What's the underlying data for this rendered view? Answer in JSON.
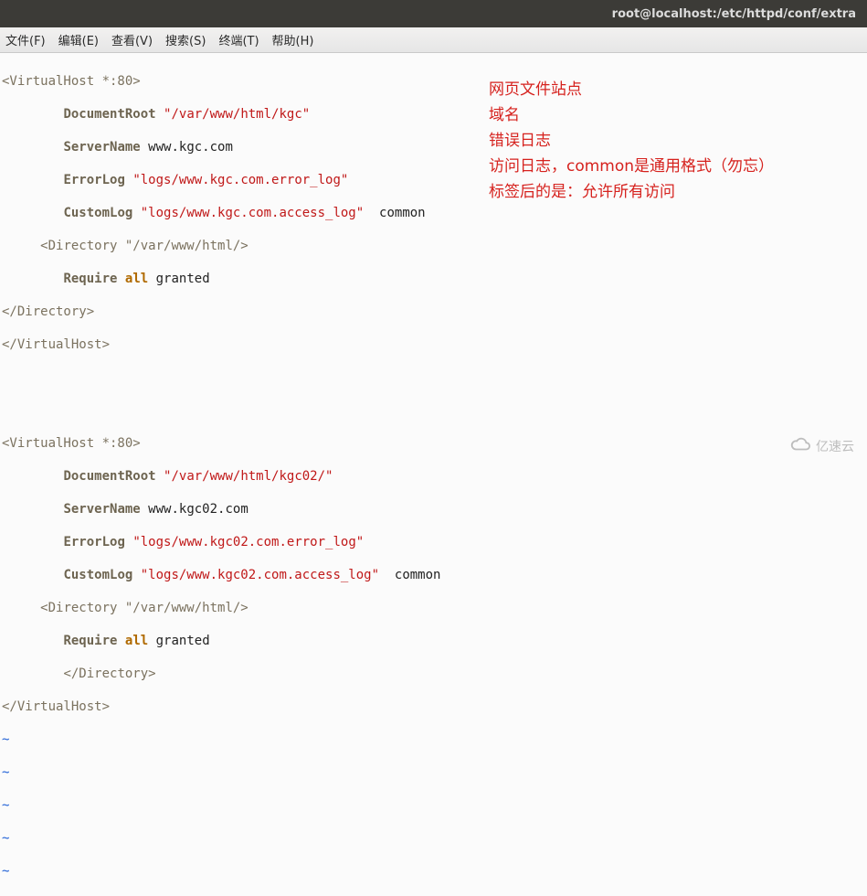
{
  "window": {
    "title": "root@localhost:/etc/httpd/conf/extra"
  },
  "menu": {
    "file": "文件(F)",
    "edit": "编辑(E)",
    "view": "查看(V)",
    "search": "搜索(S)",
    "term": "终端(T)",
    "help": "帮助(H)"
  },
  "vh1": {
    "open": "<VirtualHost *:80>",
    "docroot_k": "DocumentRoot",
    "docroot_v": "\"/var/www/html/kgc\"",
    "sname_k": "ServerName",
    "sname_v": "www.kgc.com",
    "elog_k": "ErrorLog",
    "elog_v": "\"logs/www.kgc.com.error_log\"",
    "clog_k": "CustomLog",
    "clog_v": "\"logs/www.kgc.com.access_log\"",
    "clog_fmt": "common",
    "dir_open": "<Directory \"/var/www/html/>",
    "req_k": "Require",
    "req_kw": "all",
    "req_rest": "granted",
    "dir_close": "</Directory>",
    "close": "</VirtualHost>"
  },
  "vh2": {
    "open": "<VirtualHost *:80>",
    "docroot_k": "DocumentRoot",
    "docroot_v": "\"/var/www/html/kgc02/\"",
    "sname_k": "ServerName",
    "sname_v": "www.kgc02.com",
    "elog_k": "ErrorLog",
    "elog_v": "\"logs/www.kgc02.com.error_log\"",
    "clog_k": "CustomLog",
    "clog_v": "\"logs/www.kgc02.com.access_log\"",
    "clog_fmt": "common",
    "dir_open": "<Directory \"/var/www/html/>",
    "req_k": "Require",
    "req_kw": "all",
    "req_rest": "granted",
    "dir_close": "</Directory>",
    "close": "</VirtualHost>"
  },
  "tilde": "~",
  "ann": {
    "l1": "网页文件站点",
    "l2": "域名",
    "l3": "错误日志",
    "l4": "访问日志，common是通用格式（勿忘）",
    "l5": "标签后的是：允许所有访问"
  },
  "watermark": {
    "text": "亿速云"
  }
}
